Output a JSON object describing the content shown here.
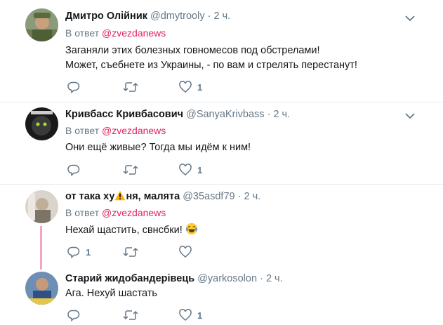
{
  "reply_prefix": "В ответ",
  "tweets": [
    {
      "name": "Дмитро Олійник",
      "handle": "@dmytrooly",
      "dot": "·",
      "time": "2 ч.",
      "reply_to": "@zvezdanews",
      "lines": [
        "Заганяли этих болезных говномесов под обстрелами!",
        "Может, съебнете из Украины, - по вам и стрелять перестанут!"
      ],
      "like_count": "1",
      "reply_count": ""
    },
    {
      "name": "Кривбасс Кривбасович",
      "handle": "@SanyaKrivbass",
      "dot": "·",
      "time": "2 ч.",
      "reply_to": "@zvezdanews",
      "lines": [
        "Они ещё живые? Тогда мы идём к ним!"
      ],
      "like_count": "1",
      "reply_count": ""
    },
    {
      "name_before": "от така ху",
      "name_after": "ня, малята",
      "handle": "@35asdf79",
      "dot": "·",
      "time": "2 ч.",
      "reply_to": "@zvezdanews",
      "lines": [
        "Нехай щастить, свнсбки!"
      ],
      "like_count": "",
      "reply_count": "1"
    },
    {
      "name": "Старий жидобандерівець",
      "handle": "@yarkosolon",
      "dot": "·",
      "time": "2 ч.",
      "lines": [
        "Ага. Нехуй шастать"
      ],
      "like_count": "1",
      "reply_count": ""
    }
  ],
  "colors": {
    "mention": "#e0245e",
    "muted": "#657786",
    "thread": "#f5a4c4"
  },
  "icons": [
    "reply-icon",
    "retweet-icon",
    "heart-icon",
    "caret-down-icon",
    "warning-icon",
    "tears-of-joy-emoji"
  ]
}
